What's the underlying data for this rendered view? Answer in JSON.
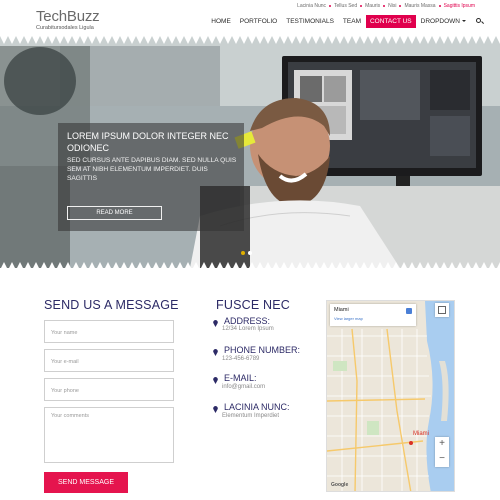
{
  "header": {
    "logo_name": "TechBuzz",
    "logo_tagline": "Curabitursodales Ligula",
    "top_links": [
      "Lacinia Nunc",
      "Tellus Sed",
      "Mauris",
      "Nisi",
      "Mauris Massa",
      "Sagittis Ipsum"
    ],
    "nav": [
      "HOME",
      "PORTFOLIO",
      "TESTIMONIALS",
      "TEAM",
      "CONTACT US",
      "DROPDOWN"
    ],
    "active_nav": "CONTACT US"
  },
  "hero": {
    "title": "LOREM IPSUM DOLOR INTEGER NEC ODIONEC",
    "text": "SED CURSUS ANTE DAPIBUS DIAM. SED NULLA QUIS SEM AT NIBH ELEMENTUM IMPERDIET. DUIS SAGITTIS",
    "button": "READ MORE",
    "slides_total": 2,
    "active_slide": 1
  },
  "contact_form": {
    "title": "SEND US A MESSAGE",
    "name_placeholder": "Your name",
    "email_placeholder": "Your e-mail",
    "phone_placeholder": "Your phone",
    "comments_placeholder": "Your comments",
    "submit": "SEND MESSAGE"
  },
  "info": {
    "title": "FUSCE NEC",
    "items": [
      {
        "label": "ADDRESS:",
        "value": "12/34 Lorem Ipsum"
      },
      {
        "label": "PHONE NUMBER:",
        "value": "123-456-6789"
      },
      {
        "label": "E-MAIL:",
        "value": "info@gmail.com"
      },
      {
        "label": "LACINIA NUNC:",
        "value": "Elementum Imperdiet"
      }
    ]
  },
  "map": {
    "city": "Miami",
    "larger_link": "View larger map",
    "label": "Miami",
    "zoom_in": "+",
    "zoom_out": "−",
    "brand": "Google"
  },
  "colors": {
    "accent": "#e0004d",
    "heading": "#2c2a66"
  }
}
